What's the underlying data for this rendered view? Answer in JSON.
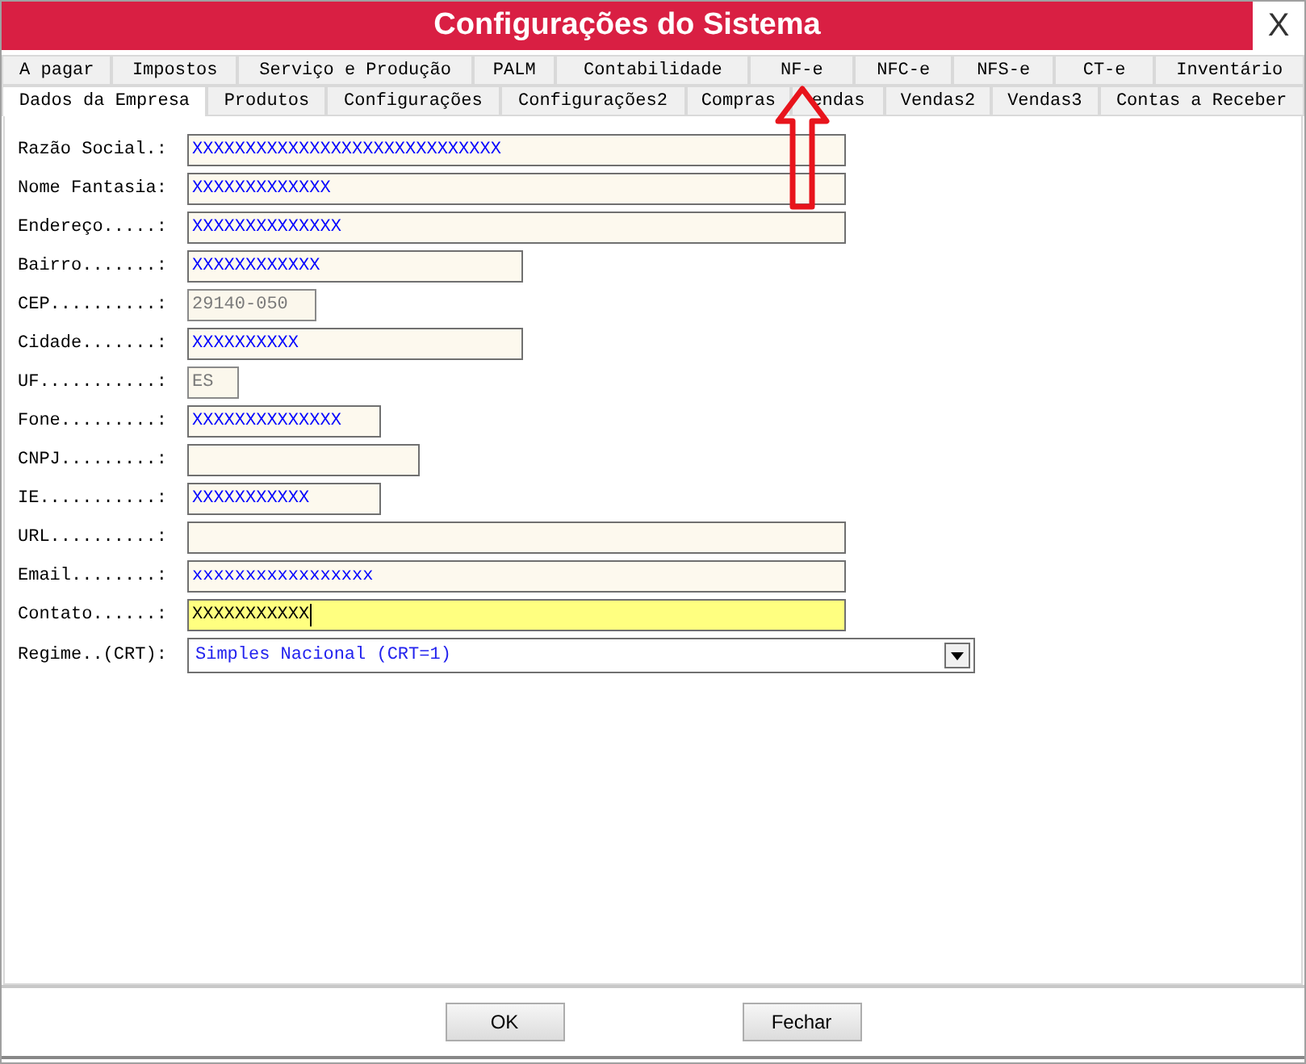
{
  "window": {
    "title": "Configurações do Sistema",
    "close": "X"
  },
  "tabs": [
    [
      {
        "label": "A pagar",
        "selected": false
      },
      {
        "label": "Impostos",
        "selected": false
      },
      {
        "label": "Serviço e Produção",
        "selected": false
      },
      {
        "label": "PALM",
        "selected": false
      },
      {
        "label": "Contabilidade",
        "selected": false
      },
      {
        "label": "NF-e",
        "selected": false
      },
      {
        "label": "NFC-e",
        "selected": false
      },
      {
        "label": "NFS-e",
        "selected": false
      },
      {
        "label": "CT-e",
        "selected": false
      },
      {
        "label": "Inventário",
        "selected": false
      }
    ],
    [
      {
        "label": "Dados da Empresa",
        "selected": true
      },
      {
        "label": "Produtos",
        "selected": false
      },
      {
        "label": "Configurações",
        "selected": false
      },
      {
        "label": "Configurações2",
        "selected": false
      },
      {
        "label": "Compras",
        "selected": false
      },
      {
        "label": "endas",
        "selected": false
      },
      {
        "label": "Vendas2",
        "selected": false
      },
      {
        "label": "Vendas3",
        "selected": false
      },
      {
        "label": "Contas a Receber",
        "selected": false
      }
    ]
  ],
  "fields": [
    {
      "label": "Razão Social.:",
      "value": "XXXXXXXXXXXXXXXXXXXXXXXXXXXXX",
      "disabled": false,
      "focused": false
    },
    {
      "label": "Nome Fantasia:",
      "value": "XXXXXXXXXXXXX",
      "disabled": false,
      "focused": false
    },
    {
      "label": "Endereço.....:",
      "value": "XXXXXXXXXXXXXX",
      "disabled": false,
      "focused": false
    },
    {
      "label": "Bairro.......:",
      "value": "XXXXXXXXXXXX",
      "disabled": false,
      "focused": false
    },
    {
      "label": "CEP..........:",
      "value": "29140-050",
      "disabled": true,
      "focused": false
    },
    {
      "label": "Cidade.......:",
      "value": "XXXXXXXXXX",
      "disabled": false,
      "focused": false
    },
    {
      "label": "UF...........:",
      "value": "ES",
      "disabled": true,
      "focused": false
    },
    {
      "label": "Fone.........:",
      "value": "XXXXXXXXXXXXXX",
      "disabled": false,
      "focused": false
    },
    {
      "label": "CNPJ.........:",
      "disabled": false,
      "focused": false
    },
    {
      "label": "IE...........:",
      "value": "XXXXXXXXXXX",
      "disabled": false,
      "focused": false
    },
    {
      "label": "URL..........:",
      "disabled": false,
      "focused": false
    },
    {
      "label": "Email........:",
      "value": "xxxxxxxxxxxxxxxxx",
      "disabled": false,
      "focused": false
    },
    {
      "label": "Contato......:",
      "value": "XXXXXXXXXXX",
      "disabled": false,
      "focused": true
    }
  ],
  "regime": {
    "label": "Regime..(CRT):",
    "value": "Simples Nacional (CRT=1)"
  },
  "buttons": [
    {
      "label": "OK"
    },
    {
      "label": "Fechar"
    }
  ]
}
